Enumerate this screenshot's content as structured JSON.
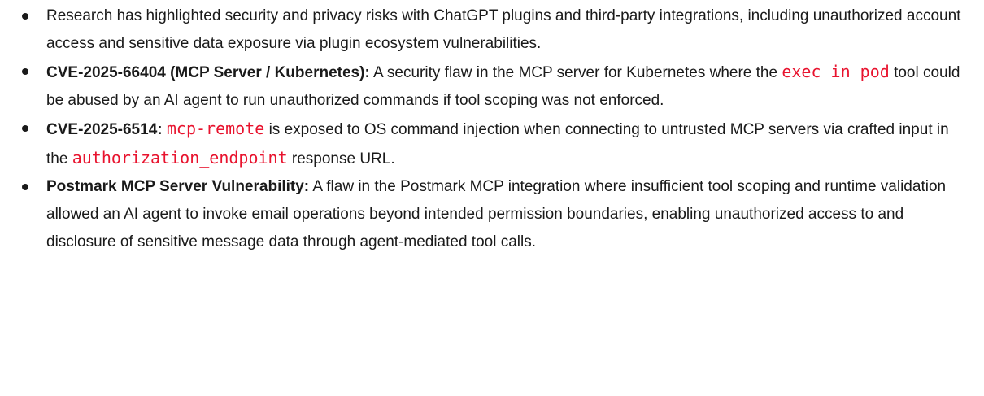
{
  "bullets": [
    {
      "text": "Research has highlighted security and privacy risks with ChatGPT plugins and third-party integrations, including unauthorized account access and sensitive data exposure via plugin ecosystem vulnerabilities."
    },
    {
      "title": "CVE-2025-66404 (MCP Server / Kubernetes):",
      "text_before": "A security flaw in the MCP server for Kubernetes where the",
      "code": "exec_in_pod",
      "text_after": "tool could be abused by an AI agent to run unauthorized commands if tool scoping was not enforced."
    },
    {
      "title": "CVE-2025-6514:",
      "code1": "mcp-remote",
      "text_mid": "is exposed to OS command injection when connecting to untrusted MCP servers via crafted input in the",
      "code2": "authorization_endpoint",
      "text_after": "response URL."
    },
    {
      "title": "Postmark MCP Server Vulnerability:",
      "text": "A flaw in the Postmark MCP integration where insufficient tool scoping and runtime validation allowed an AI agent to invoke email operations beyond intended permission boundaries, enabling unauthorized access to and disclosure of sensitive message data through agent-mediated tool calls."
    }
  ]
}
